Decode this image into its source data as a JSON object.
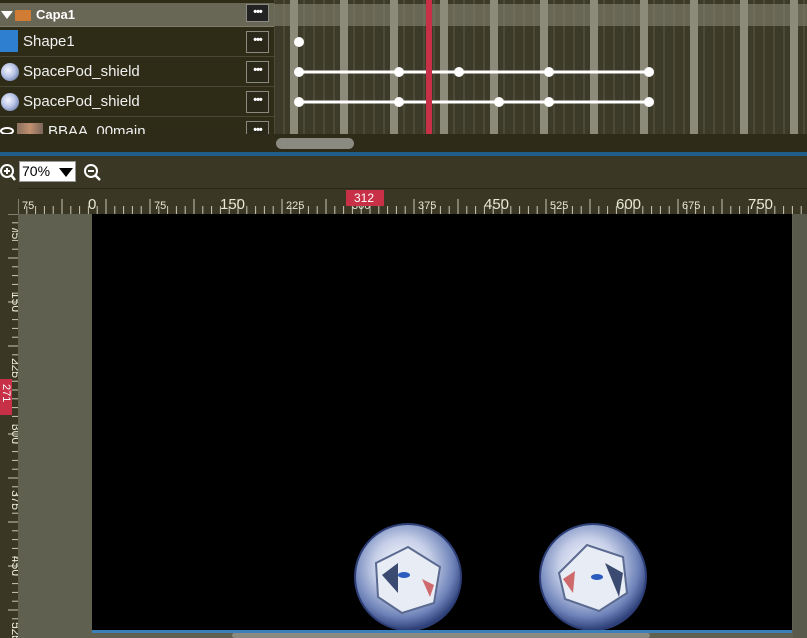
{
  "layers": [
    {
      "name": "Capa1",
      "type": "group",
      "menu": "•••"
    },
    {
      "name": "Shape1",
      "type": "shape",
      "menu": "•••"
    },
    {
      "name": "SpacePod_shield",
      "type": "pod",
      "menu": "•••"
    },
    {
      "name": "SpacePod_shield",
      "type": "pod",
      "menu": "•••"
    },
    {
      "name": "BBAA_00main",
      "type": "image",
      "menu": "•••"
    }
  ],
  "zoom": {
    "value": "70%"
  },
  "rulers": {
    "horizontal_labels": [
      "75",
      "0",
      "75",
      "150",
      "225",
      "300",
      "375",
      "450",
      "525",
      "600",
      "675",
      "750",
      "8"
    ],
    "vertical_labels": [
      "75",
      "150",
      "225",
      "300",
      "375",
      "450",
      "525"
    ],
    "cursor_x": "312",
    "cursor_y": "271"
  },
  "colors": {
    "playhead": "#c83048",
    "stage": "#000000",
    "panel": "#3a3824",
    "accent": "#1f5e8a"
  },
  "icons": {
    "zoom_in": "zoom-in-icon",
    "zoom_out": "zoom-out-icon"
  }
}
